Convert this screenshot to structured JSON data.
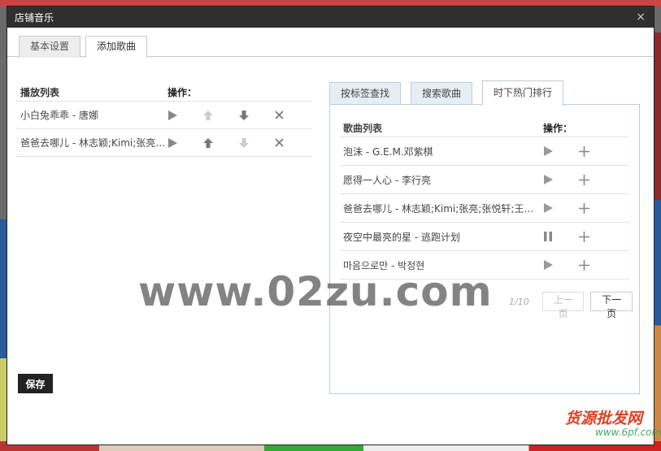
{
  "dialog": {
    "title": "店铺音乐",
    "close_icon": "×",
    "tabs": [
      {
        "label": "基本设置",
        "active": false
      },
      {
        "label": "添加歌曲",
        "active": true
      }
    ]
  },
  "playlist": {
    "header_name": "播放列表",
    "header_ops": "操作：",
    "rows": [
      {
        "title": "小白兔乖乖 - 唐娜"
      },
      {
        "title": "爸爸去哪儿 - 林志颖;Kimi;张亮;张悦轩;王岳伦;王诗龄;田亮;森碟;郭涛;石头"
      }
    ],
    "save_label": "保存"
  },
  "search": {
    "tabs": [
      {
        "label": "按标签查找",
        "active": false
      },
      {
        "label": "搜索歌曲",
        "active": false
      },
      {
        "label": "时下热门排行",
        "active": true
      }
    ],
    "header_name": "歌曲列表",
    "header_ops": "操作：",
    "rows": [
      {
        "title": "泡沫 - G.E.M.邓紫棋",
        "playing": false
      },
      {
        "title": "愿得一人心 - 李行亮",
        "playing": false
      },
      {
        "title": "爸爸去哪儿 - 林志颖;Kimi;张亮;张悦轩;王岳伦",
        "playing": false
      },
      {
        "title": "夜空中最亮的星 - 逃跑计划",
        "playing": true
      },
      {
        "title": "마음으로만 - 박정현",
        "playing": false
      }
    ],
    "pager": {
      "count": "1/10",
      "prev_label": "上一页",
      "next_label": "下一页"
    }
  },
  "overlays": {
    "watermark_main": "www.02zu.com",
    "watermark_corner": "货源批发网",
    "watermark_url": "www.6pf.com"
  },
  "colors": {
    "titlebar": "#2f2f2f",
    "panel_border": "#b7cfdc",
    "icon_active": "#888888",
    "icon_disabled": "#cccccc"
  }
}
